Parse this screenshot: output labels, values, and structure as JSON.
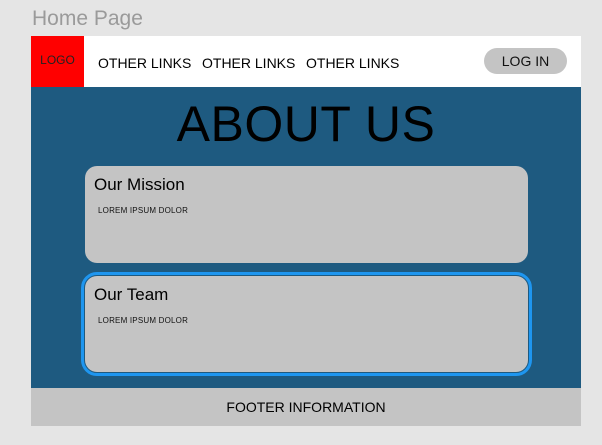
{
  "canvas": {
    "title": "Home Page"
  },
  "header": {
    "logo": "LOGO",
    "links": [
      "OTHER LINKS",
      "OTHER LINKS",
      "OTHER LINKS"
    ],
    "login_label": "LOG IN"
  },
  "main": {
    "heading": "ABOUT US",
    "cards": [
      {
        "title": "Our Mission",
        "body": "LOREM IPSUM DOLOR"
      },
      {
        "title": "Our Team",
        "body": "LOREM IPSUM DOLOR"
      }
    ]
  },
  "footer": {
    "text": "FOOTER INFORMATION"
  },
  "colors": {
    "canvas_bg": "#e5e5e5",
    "logo_bg": "#ff0000",
    "main_bg": "#1e5a80",
    "card_bg": "#c4c4c4",
    "selection": "#1e96f0"
  }
}
